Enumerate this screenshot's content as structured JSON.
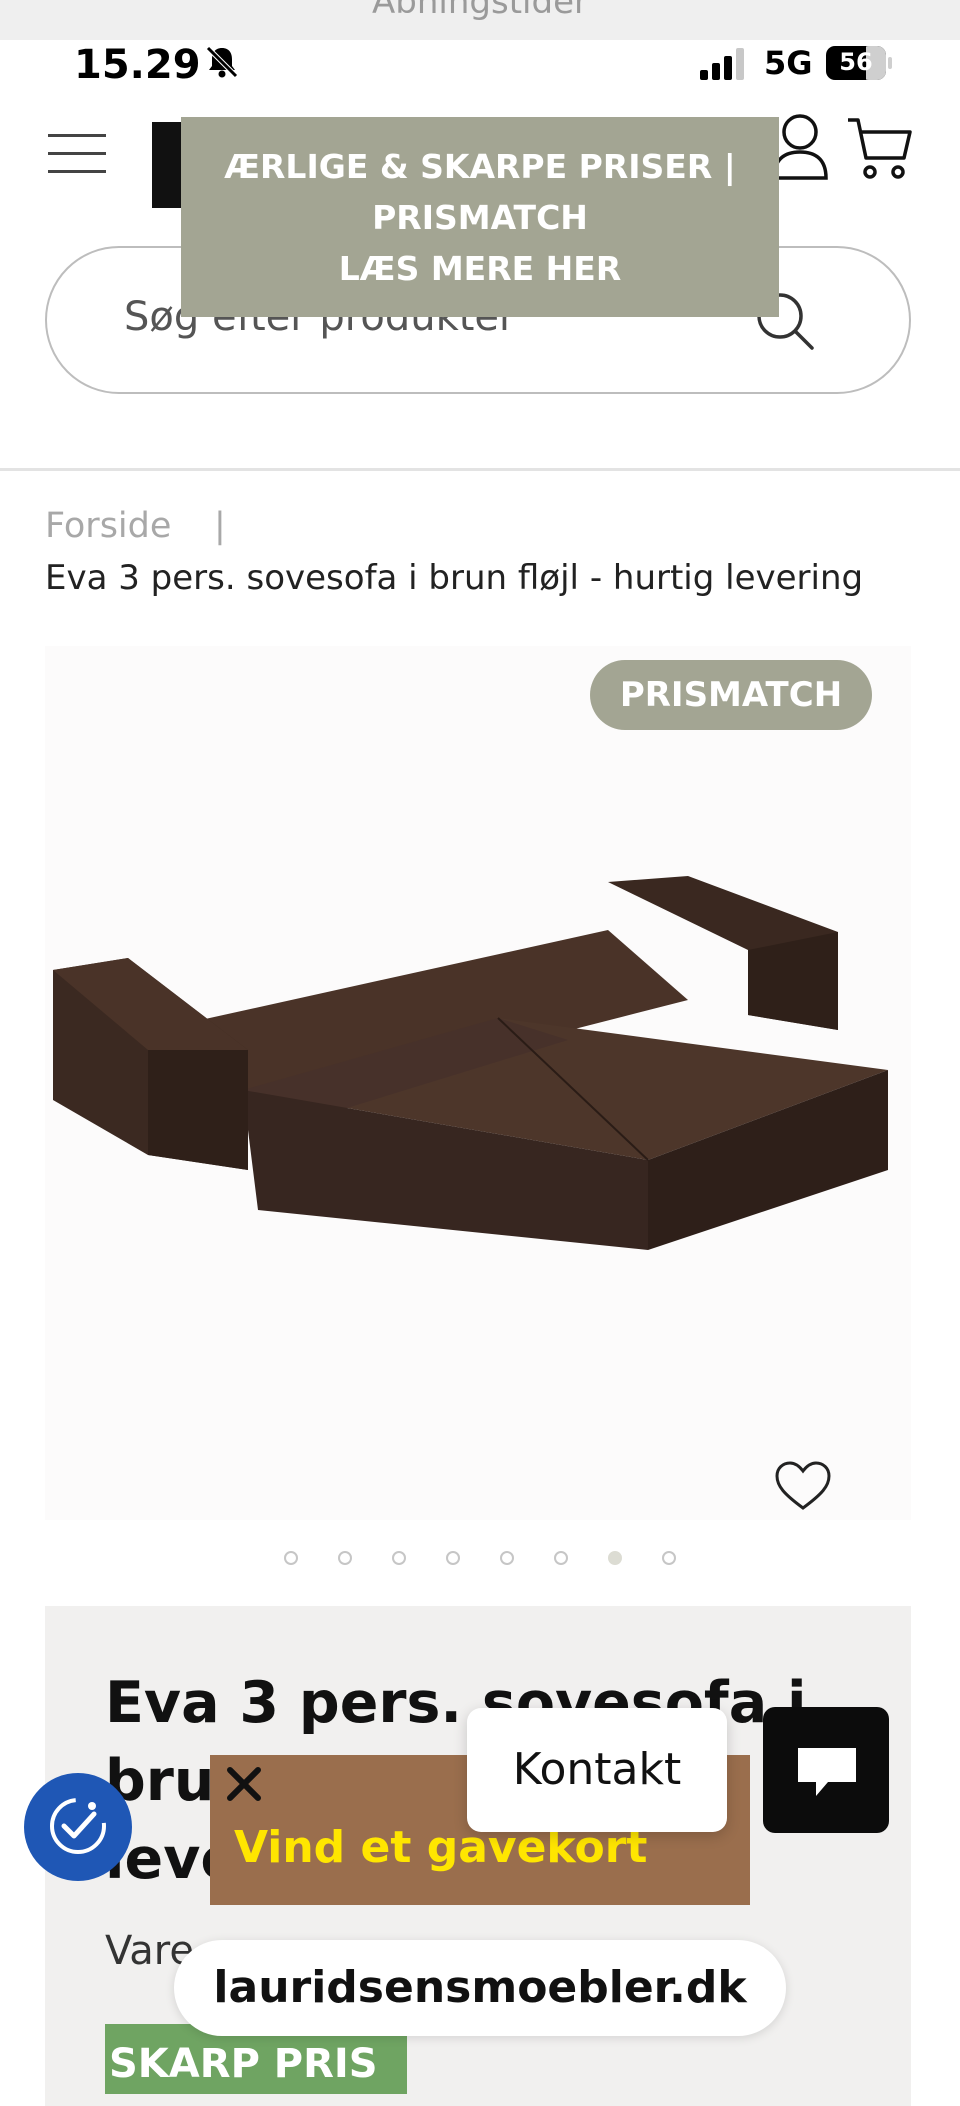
{
  "top_strip": {
    "text": "Åbningstider"
  },
  "status_bar": {
    "time": "15.29",
    "network": "5G",
    "battery": "56"
  },
  "header": {
    "promo_line1": "ÆRLIGE & SKARPE PRISER |",
    "promo_line2": "PRISMATCH",
    "promo_line3": "LÆS MERE HER"
  },
  "search": {
    "placeholder": "Søg efter produkter"
  },
  "breadcrumb": {
    "home": "Forside",
    "separator": "|",
    "current": "Eva 3 pers. sovesofa i brun fløjl - hurtig levering"
  },
  "gallery": {
    "badge": "PRISMATCH",
    "image_count": 8,
    "active_index": 6
  },
  "product": {
    "title_line1": "Eva 3 pers. sovesofa i",
    "title_line2": "bru",
    "title_line3": "leve",
    "sku_label": "Vare",
    "price_badge": "SKARP PRIS"
  },
  "overlays": {
    "gift_text": "Vind et gavekort",
    "contact_label": "Kontakt",
    "url": "lauridsensmoebler.dk"
  },
  "colors": {
    "promo": "#a3a593",
    "price_badge": "#6fa462",
    "gift_banner": "#9a6e4d",
    "gift_text": "#ffe600",
    "accessibility": "#1f57b5",
    "sofa": "#3e2a22"
  }
}
